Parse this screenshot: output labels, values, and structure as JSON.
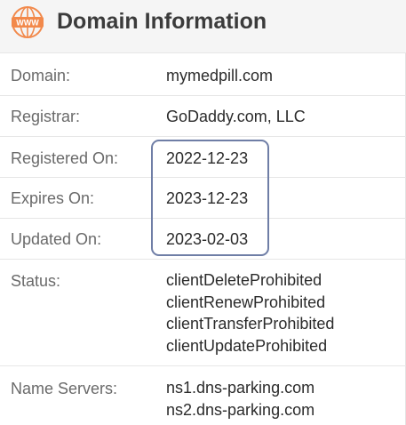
{
  "header": {
    "icon_name": "www-icon",
    "icon_text": "WWW",
    "icon_color": "#f2894b",
    "title": "Domain Information"
  },
  "rows": {
    "domain": {
      "label": "Domain:",
      "value": "mymedpill.com"
    },
    "registrar": {
      "label": "Registrar:",
      "value": "GoDaddy.com, LLC"
    },
    "registered": {
      "label": "Registered On:",
      "value": "2022-12-23"
    },
    "expires": {
      "label": "Expires On:",
      "value": "2023-12-23"
    },
    "updated": {
      "label": "Updated On:",
      "value": "2023-02-03"
    },
    "status": {
      "label": "Status:",
      "values": [
        "clientDeleteProhibited",
        "clientRenewProhibited",
        "clientTransferProhibited",
        "clientUpdateProhibited"
      ]
    },
    "name_servers": {
      "label": "Name Servers:",
      "values": [
        "ns1.dns-parking.com",
        "ns2.dns-parking.com"
      ]
    }
  },
  "highlight_color": "#6f7ea6"
}
